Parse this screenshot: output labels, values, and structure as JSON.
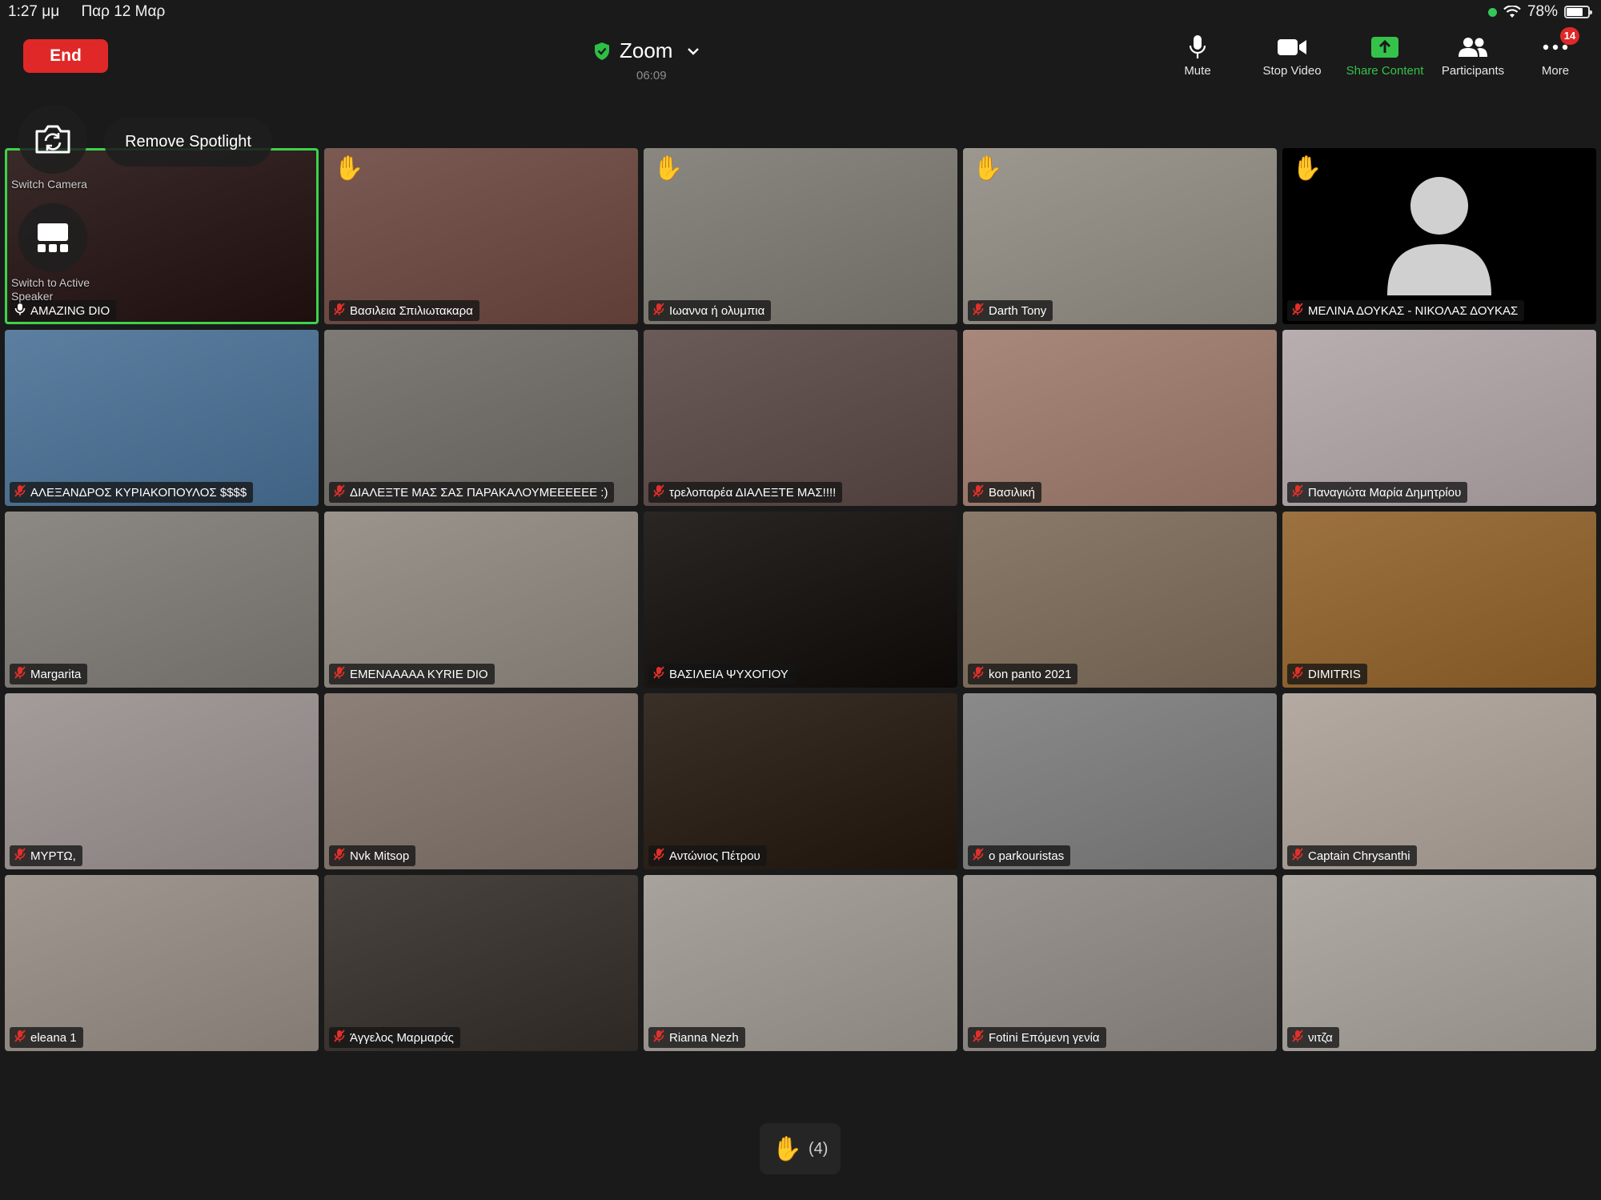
{
  "status_bar": {
    "time": "1:27 μμ",
    "date": "Παρ 12 Μαρ",
    "battery": "78%",
    "battery_level": 0.78
  },
  "toolbar": {
    "end_label": "End",
    "meeting_name": "Zoom",
    "timer": "06:09",
    "mute_label": "Mute",
    "stop_video_label": "Stop Video",
    "share_label": "Share Content",
    "participants_label": "Participants",
    "more_label": "More",
    "more_badge": "14"
  },
  "spotlight": {
    "remove_label": "Remove Spotlight",
    "switch_camera_label": "Switch Camera",
    "switch_speaker_label": "Switch to Active Speaker"
  },
  "colors": {
    "end_red": "#e02828",
    "active_green": "#3dd34a",
    "share_green": "#35c24a",
    "muted_red": "#e0302a"
  },
  "participants": [
    {
      "name": "AMAZING DIO",
      "hand": false,
      "active": true,
      "muted": false,
      "bg": "#3a2a2a"
    },
    {
      "name": "Βασιλεια Σπιλιωτακαρα",
      "hand": true,
      "bg": "#7a5a52"
    },
    {
      "name": "Ιωαννα ή ολυμπια",
      "hand": true,
      "bg": "#8a8780"
    },
    {
      "name": "Darth Tony",
      "hand": true,
      "bg": "#9c9890"
    },
    {
      "name": "ΜΕΛΙΝΑ ΔΟΥΚΑΣ - ΝΙΚΟΛΑΣ ΔΟΥΚΑΣ",
      "hand": true,
      "avatar": true,
      "bg": "#000000"
    },
    {
      "name": "ΑΛΕΞΑΝΔΡΟΣ ΚΥΡΙΑΚΟΠΟΥΛΟΣ $$$$",
      "bg": "#5c7fa0"
    },
    {
      "name": "ΔΙΑΛΕΞΤΕ ΜΑΣ ΣΑΣ ΠΑΡΑΚΑΛΟΥΜΕΕΕΕΕΕ :)",
      "bg": "#7e7a76"
    },
    {
      "name": "τρελοπαρέα ΔΙΑΛΕΞΤΕ ΜΑΣ!!!!",
      "bg": "#6a5a58"
    },
    {
      "name": "Βασιλική",
      "bg": "#a8887a"
    },
    {
      "name": "Παναγιώτα Μαρία Δημητρίου",
      "bg": "#b8aeb0"
    },
    {
      "name": "Margarita",
      "bg": "#8c8884"
    },
    {
      "name": "EMENAAAAA KYRIE DIO",
      "bg": "#9a948c"
    },
    {
      "name": "ΒΑΣΙΛΕΙΑ ΨΥΧΟΓΙΟΥ",
      "bg": "#2a2624"
    },
    {
      "name": "kon panto 2021",
      "bg": "#8a7a6a"
    },
    {
      "name": "DIMITRIS",
      "bg": "#9c7240"
    },
    {
      "name": "ΜΥΡΤΩ,",
      "bg": "#a49c9a"
    },
    {
      "name": "Nvk Mitsop",
      "bg": "#8c8078"
    },
    {
      "name": "Αντώνιος Πέτρου",
      "bg": "#3a3028"
    },
    {
      "name": "o parkouristas",
      "bg": "#8a8a8a"
    },
    {
      "name": "Captain Chrysanthi",
      "bg": "#b4aaa2"
    },
    {
      "name": "eleana 1",
      "bg": "#a09890"
    },
    {
      "name": "Άγγελος Μαρμαράς",
      "bg": "#4a4440"
    },
    {
      "name": "Rianna Nezh",
      "bg": "#a8a29c"
    },
    {
      "name": "Fotini Επόμενη γενία",
      "bg": "#9a9490"
    },
    {
      "name": "νιτζα",
      "bg": "#b0aaa4"
    }
  ],
  "raised_hands": {
    "count_label": "(4)"
  }
}
